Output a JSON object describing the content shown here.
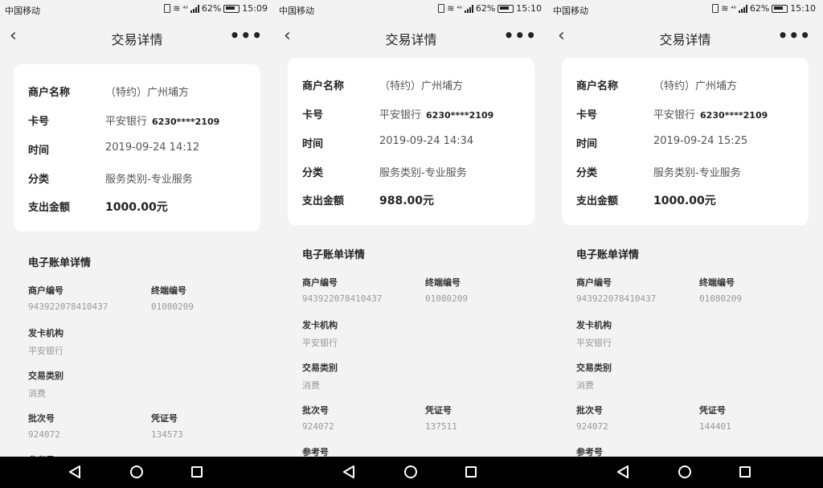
{
  "screens": [
    {
      "status": {
        "carrier": "中国移动",
        "signal": "⁴⁶",
        "battery": "62%",
        "time": "15:09"
      },
      "nav": {
        "back": "‹",
        "title": "交易详情",
        "more": "•••"
      },
      "card": {
        "merchant_label": "商户名称",
        "merchant_value": "（特约）广州埔方",
        "card_label": "卡号",
        "bank": "平安银行",
        "card_no": "6230****2109",
        "time_label": "时间",
        "time_value": "2019-09-24 14:12",
        "category_label": "分类",
        "category_value": "服务类别-专业服务",
        "amount_label": "支出金额",
        "amount_value": "1000.00元"
      },
      "bill": {
        "title": "电子账单详情",
        "merchant_no_label": "商户编号",
        "merchant_no": "943922078410437",
        "terminal_no_label": "终端编号",
        "terminal_no": "01080209",
        "issuer_label": "发卡机构",
        "issuer": "平安银行",
        "txn_type_label": "交易类别",
        "txn_type": "消费",
        "batch_label": "批次号",
        "batch": "924072",
        "voucher_label": "凭证号",
        "voucher": "134573",
        "ref_label": "参考号"
      }
    },
    {
      "status": {
        "carrier": "中国移动",
        "signal": "⁴⁶",
        "battery": "62%",
        "time": "15:10"
      },
      "nav": {
        "back": "‹",
        "title": "交易详情",
        "more": "•••"
      },
      "card": {
        "merchant_label": "商户名称",
        "merchant_value": "（特约）广州埔方",
        "card_label": "卡号",
        "bank": "平安银行",
        "card_no": "6230****2109",
        "time_label": "时间",
        "time_value": "2019-09-24 14:34",
        "category_label": "分类",
        "category_value": "服务类别-专业服务",
        "amount_label": "支出金额",
        "amount_value": "988.00元"
      },
      "bill": {
        "title": "电子账单详情",
        "merchant_no_label": "商户编号",
        "merchant_no": "943922078410437",
        "terminal_no_label": "终端编号",
        "terminal_no": "01080209",
        "issuer_label": "发卡机构",
        "issuer": "平安银行",
        "txn_type_label": "交易类别",
        "txn_type": "消费",
        "batch_label": "批次号",
        "batch": "924072",
        "voucher_label": "凭证号",
        "voucher": "137511",
        "ref_label": "参考号"
      }
    },
    {
      "status": {
        "carrier": "中国移动",
        "signal": "⁴⁶",
        "battery": "62%",
        "time": "15:10"
      },
      "nav": {
        "back": "‹",
        "title": "交易详情",
        "more": "•••"
      },
      "card": {
        "merchant_label": "商户名称",
        "merchant_value": "（特约）广州埔方",
        "card_label": "卡号",
        "bank": "平安银行",
        "card_no": "6230****2109",
        "time_label": "时间",
        "time_value": "2019-09-24 15:25",
        "category_label": "分类",
        "category_value": "服务类别-专业服务",
        "amount_label": "支出金额",
        "amount_value": "1000.00元"
      },
      "bill": {
        "title": "电子账单详情",
        "merchant_no_label": "商户编号",
        "merchant_no": "943922078410437",
        "terminal_no_label": "终端编号",
        "terminal_no": "01080209",
        "issuer_label": "发卡机构",
        "issuer": "平安银行",
        "txn_type_label": "交易类别",
        "txn_type": "消费",
        "batch_label": "批次号",
        "batch": "924072",
        "voucher_label": "凭证号",
        "voucher": "144401",
        "ref_label": "参考号"
      }
    }
  ],
  "icons": {
    "vibrate": "vibrate-icon",
    "wifi": "wifi-icon",
    "signal": "signal-icon",
    "battery": "battery-icon",
    "back": "back-arrow-icon",
    "more": "more-dots-icon",
    "nav_back": "android-back-icon",
    "nav_home": "android-home-icon",
    "nav_recent": "android-recent-icon"
  },
  "colors": {
    "background": "#f3f3f3",
    "card": "#ffffff",
    "nav_bar": "#000000",
    "muted_text": "#999999"
  }
}
